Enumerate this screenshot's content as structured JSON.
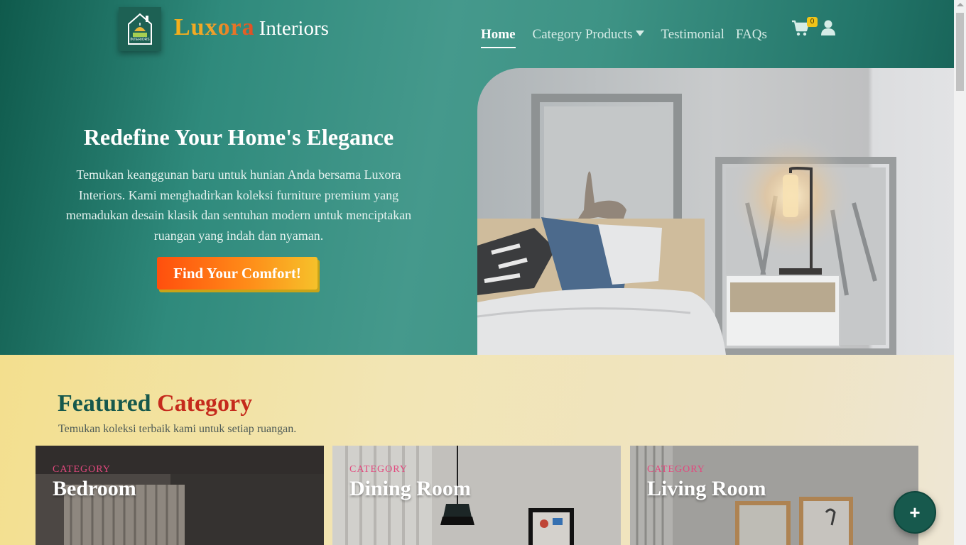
{
  "brand": {
    "name_part1": "Luxora",
    "name_part2": "Interiors",
    "logo_text": "INTERIORS"
  },
  "nav": {
    "items": [
      {
        "label": "Home",
        "active": true
      },
      {
        "label": "Category Products",
        "active": false,
        "has_dropdown": true
      },
      {
        "label": "Testimonial",
        "active": false
      },
      {
        "label": "FAQs",
        "active": false
      }
    ],
    "cart_count": "0",
    "icons": [
      "cart-icon",
      "user-icon",
      "chevron-down-icon"
    ]
  },
  "hero": {
    "title": "Redefine Your Home's Elegance",
    "description": "Temukan keanggunan baru untuk hunian Anda bersama Luxora Interiors. Kami menghadirkan koleksi furniture premium yang memadukan desain klasik dan sentuhan modern untuk menciptakan ruangan yang indah dan nyaman.",
    "cta_label": "Find Your Comfort!"
  },
  "featured": {
    "title_part1": "Featured",
    "title_part2": "Category",
    "subtitle": "Temukan koleksi terbaik kami untuk setiap ruangan.",
    "cards": [
      {
        "kicker": "CATEGORY",
        "name": "Bedroom"
      },
      {
        "kicker": "CATEGORY",
        "name": "Dining Room"
      },
      {
        "kicker": "CATEGORY",
        "name": "Living Room"
      }
    ]
  },
  "fab": {
    "label": "+"
  },
  "colors": {
    "primary": "#17594d",
    "accent_red": "#c52a1c",
    "accent_orange": "#ff6a12",
    "cream": "#f3e6b6"
  }
}
